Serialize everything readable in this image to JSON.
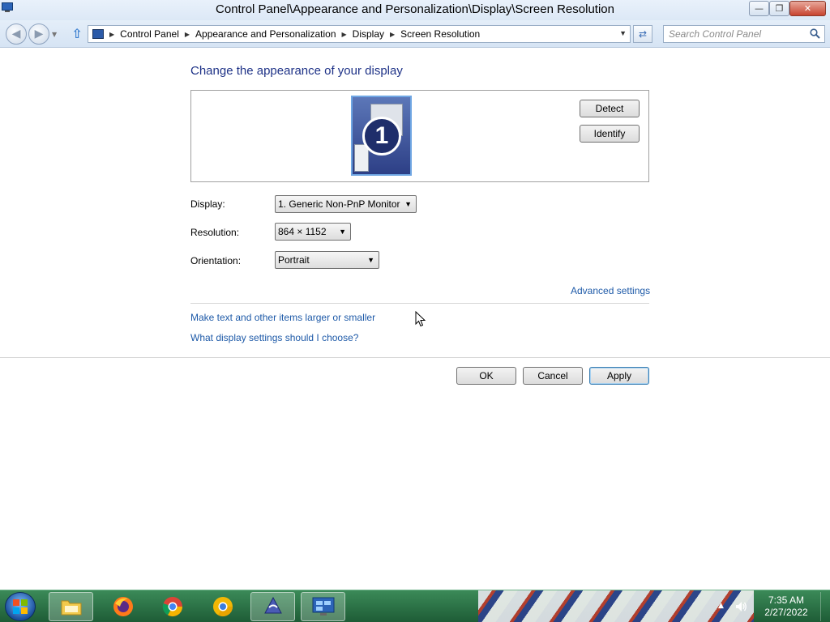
{
  "window": {
    "title": "Control Panel\\Appearance and Personalization\\Display\\Screen Resolution",
    "minimize_label": "—",
    "maximize_label": "❐",
    "close_label": "✕"
  },
  "navigation": {
    "breadcrumbs": [
      "Control Panel",
      "Appearance and Personalization",
      "Display",
      "Screen Resolution"
    ],
    "search_placeholder": "Search Control Panel"
  },
  "main": {
    "heading": "Change the appearance of your display",
    "monitor_number": "1",
    "detect_label": "Detect",
    "identify_label": "Identify",
    "display_label": "Display:",
    "display_value": "1. Generic Non-PnP Monitor",
    "resolution_label": "Resolution:",
    "resolution_value": "864 × 1152",
    "orientation_label": "Orientation:",
    "orientation_value": "Portrait",
    "advanced_link": "Advanced settings",
    "text_size_link": "Make text and other items larger or smaller",
    "help_link": "What display settings should I choose?",
    "ok_label": "OK",
    "cancel_label": "Cancel",
    "apply_label": "Apply"
  },
  "taskbar": {
    "items": [
      "start",
      "file-explorer",
      "firefox",
      "chrome",
      "chromium",
      "inkscape",
      "control-panel"
    ],
    "time": "7:35 AM",
    "date": "2/27/2022"
  },
  "colors": {
    "heading": "#1e3287",
    "link": "#1e5aa8",
    "taskbar": "#2f7a4a"
  }
}
